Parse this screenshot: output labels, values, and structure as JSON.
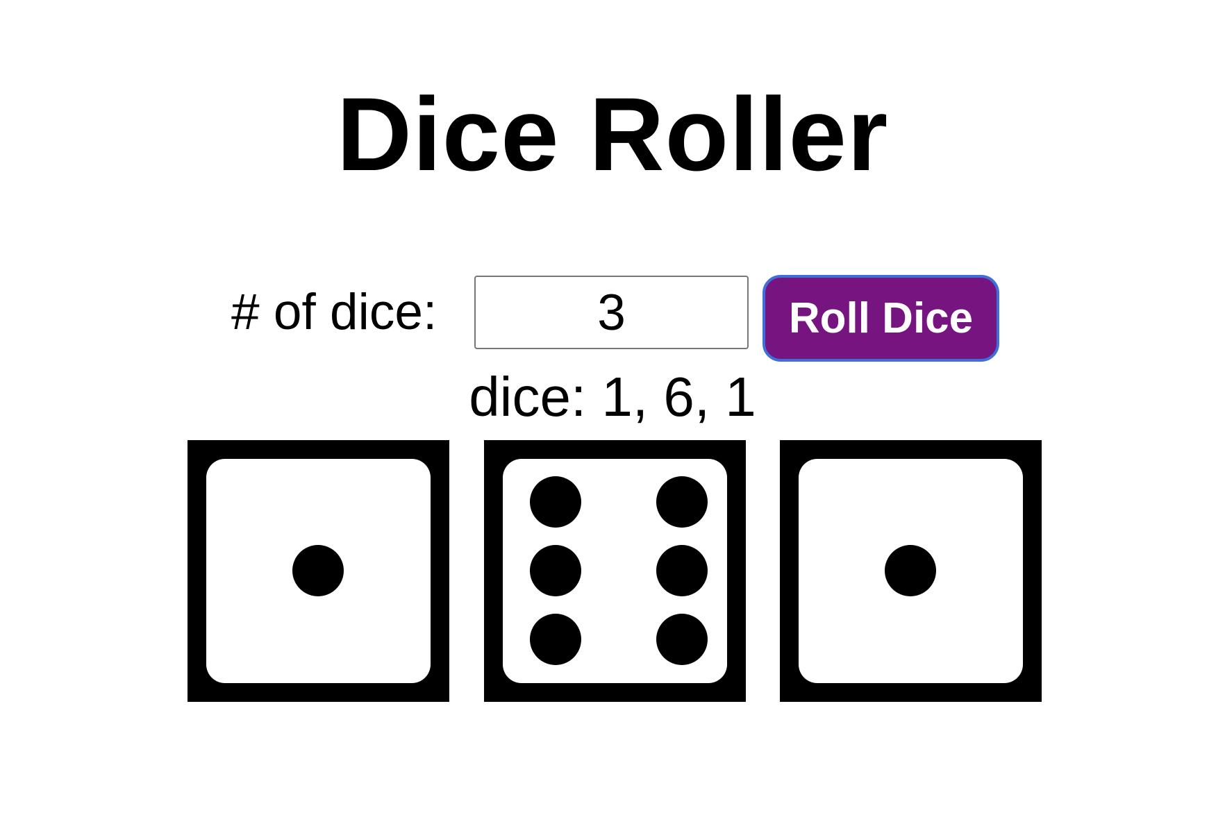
{
  "app": {
    "title": "Dice Roller"
  },
  "controls": {
    "count_label": "# of dice:",
    "count_value": "3",
    "roll_button_label": "Roll Dice"
  },
  "result": {
    "label": "dice:",
    "values_text": "1, 6, 1"
  },
  "dice": [
    {
      "face": 1
    },
    {
      "face": 6
    },
    {
      "face": 1
    }
  ],
  "colors": {
    "button_background": "#76157f",
    "button_border": "#3f6fd8",
    "button_text": "#ffffff",
    "die_frame": "#000000",
    "die_face": "#ffffff",
    "pip": "#000000"
  }
}
